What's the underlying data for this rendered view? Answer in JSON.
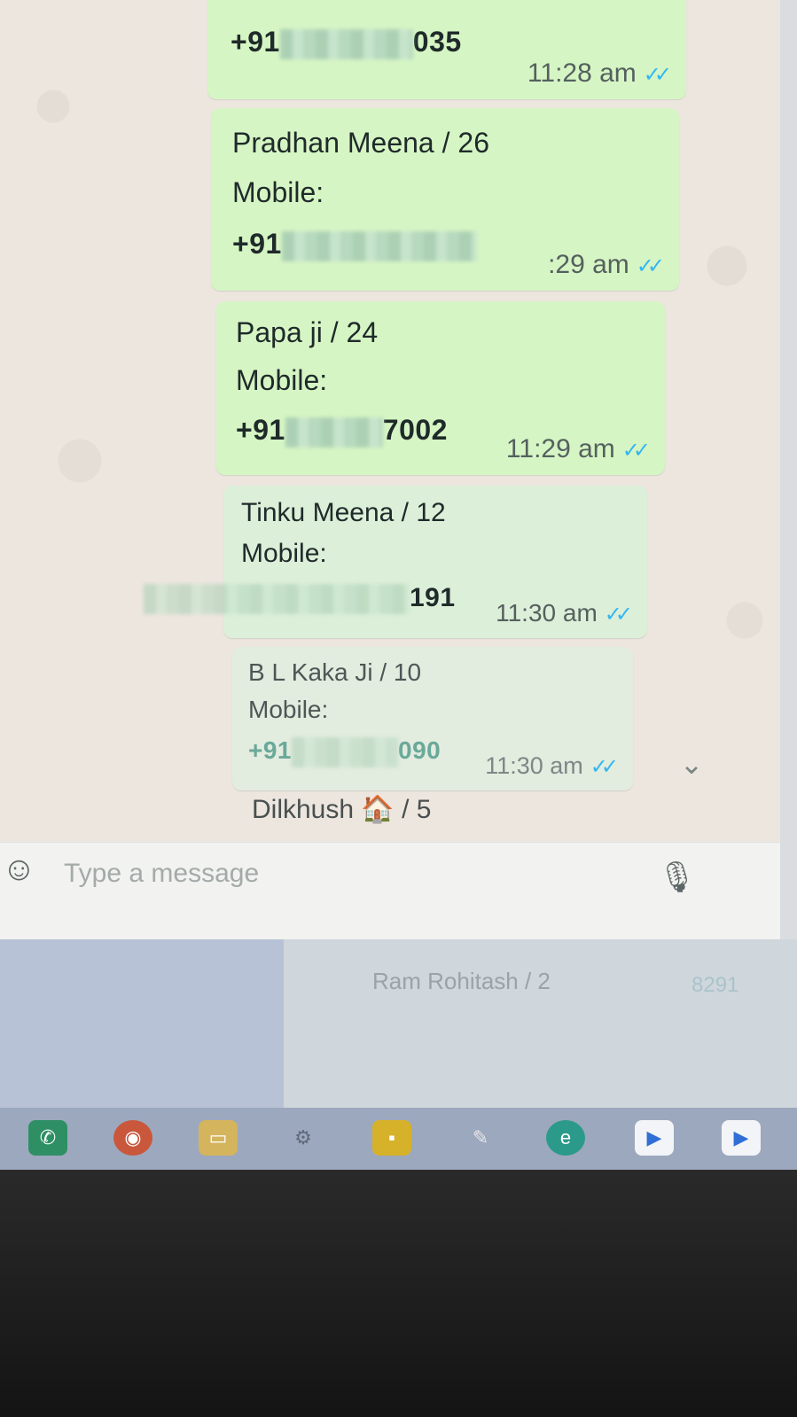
{
  "messages": [
    {
      "name": "",
      "label": "",
      "number_prefix": "+91",
      "number_suffix": "035",
      "time": "11:28 am"
    },
    {
      "name": "Pradhan Meena / 26",
      "label": "Mobile:",
      "number_prefix": "+91",
      "number_suffix": "",
      "time": ":29 am"
    },
    {
      "name": "Papa ji / 24",
      "label": "Mobile:",
      "number_prefix": "+91",
      "number_suffix": "7002",
      "time": "11:29 am"
    },
    {
      "name": "Tinku Meena / 12",
      "label": "Mobile:",
      "number_prefix": "",
      "number_suffix": "191",
      "time": "11:30 am"
    },
    {
      "name": "B L Kaka Ji / 10",
      "label": "Mobile:",
      "number_prefix": "+91",
      "number_suffix": "090",
      "time": "11:30 am"
    }
  ],
  "preview": {
    "text": "Dilkhush 🏠 / 5"
  },
  "composer": {
    "placeholder": "Type a message"
  },
  "icons": {
    "read_receipt": "double-check-icon",
    "emoji": "emoji-icon",
    "mic": "mic-icon",
    "scroll": "chevron-down-icon"
  },
  "background_list": {
    "name": "Ram Rohitash / 2",
    "number": "8291"
  },
  "taskbar": [
    "whatsapp-icon",
    "chrome-icon",
    "file-explorer-icon",
    "settings-icon",
    "sticky-notes-icon",
    "feather-icon",
    "edge-icon",
    "app-icon",
    "app-icon"
  ]
}
